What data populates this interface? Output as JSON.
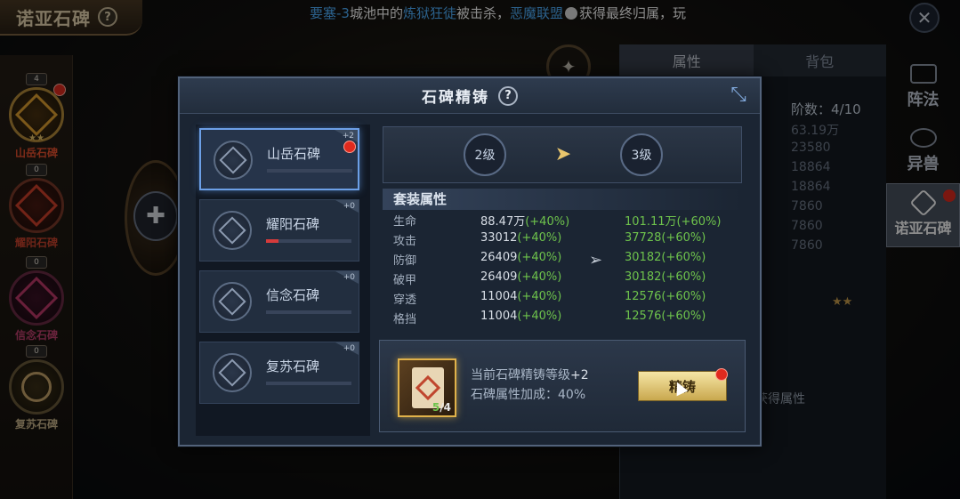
{
  "header": {
    "title": "诺亚石碑",
    "help": "?",
    "broadcast": {
      "part1": "要塞-3",
      "part2": "城池中的",
      "part3": "炼狱狂徒",
      "part4": "被击杀，",
      "part5": "恶魔联盟",
      "part6": "获得最终归属，玩"
    },
    "close": "✕"
  },
  "left_steles": [
    {
      "count": "4",
      "name": "山岳石碑",
      "color": "#e0a030",
      "stars": "★★"
    },
    {
      "count": "0",
      "name": "耀阳石碑",
      "color": "#d0402a"
    },
    {
      "count": "0",
      "name": "信念石碑",
      "color": "#c03a6a"
    },
    {
      "count": "0",
      "name": "复苏石碑",
      "color": "#c7a56a"
    }
  ],
  "right_panel": {
    "tabs": [
      "属性",
      "背包"
    ],
    "stage": "阶数：4/10",
    "values": [
      "63.19万",
      "23580",
      "18864",
      "18864",
      "7860",
      "7860",
      "7860"
    ],
    "stars": "★★",
    "note": "获得属性"
  },
  "side_tabs": [
    "阵法",
    "异兽",
    "诺亚石碑"
  ],
  "modal": {
    "title": "石碑精铸",
    "help": "?",
    "steles": [
      {
        "name": "山岳石碑",
        "plus": "+2",
        "progress": 0.0,
        "selected": true
      },
      {
        "name": "耀阳石碑",
        "plus": "+0",
        "progress": 0.15,
        "selected": false
      },
      {
        "name": "信念石碑",
        "plus": "+0",
        "progress": 0.0,
        "selected": false
      },
      {
        "name": "复苏石碑",
        "plus": "+0",
        "progress": 0.0,
        "selected": false
      }
    ],
    "level_from": "2级",
    "level_to": "3级",
    "attr_header": "套装属性",
    "attributes": [
      {
        "name": "生命",
        "cur": "88.47万",
        "cur_pct": "(+40%)",
        "next": "101.11万(+60%)"
      },
      {
        "name": "攻击",
        "cur": "33012",
        "cur_pct": "(+40%)",
        "next": "37728(+60%)"
      },
      {
        "name": "防御",
        "cur": "26409",
        "cur_pct": "(+40%)",
        "next": "30182(+60%)"
      },
      {
        "name": "破甲",
        "cur": "26409",
        "cur_pct": "(+40%)",
        "next": "30182(+60%)"
      },
      {
        "name": "穿透",
        "cur": "11004",
        "cur_pct": "(+40%)",
        "next": "12576(+60%)"
      },
      {
        "name": "格挡",
        "cur": "11004",
        "cur_pct": "(+40%)",
        "next": "12576(+60%)"
      }
    ],
    "craft": {
      "item_have": "5",
      "item_need": "/4",
      "info1_label": "当前石碑精铸等级",
      "info1_value": "+2",
      "info2": "石碑属性加成：40%",
      "button": "精铸"
    }
  }
}
